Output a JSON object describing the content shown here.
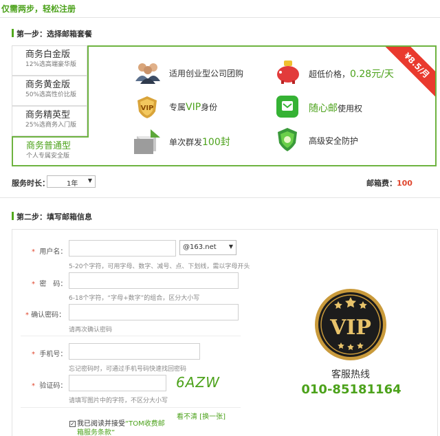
{
  "header": {
    "title": "仅需两步，轻松注册"
  },
  "step1": {
    "title": "第一步：选择邮箱套餐"
  },
  "plans": [
    {
      "name": "商务白金版",
      "desc": "12%选高端豪华版"
    },
    {
      "name": "商务黄金版",
      "desc": "50%选高性价比版"
    },
    {
      "name": "商务精英型",
      "desc": "25%选商务入门版"
    },
    {
      "name": "商务普通型",
      "desc": "个人专属安全版"
    }
  ],
  "features": {
    "f1": "适用创业型公司团购",
    "f2_prefix": "超低价格，",
    "f2_price": "0.28元/天",
    "f3_prefix": "专属",
    "f3_vip": "VIP",
    "f3_suffix": "身份",
    "f4_prefix": "随心邮",
    "f4_suffix": "使用权",
    "f5_prefix": "单次群发",
    "f5_num": "100封",
    "f6": "高级安全防护"
  },
  "ribbon": {
    "price": "¥8.5/月"
  },
  "service": {
    "label": "服务时长：",
    "duration": "1年",
    "fee_label": "邮箱费：",
    "fee_value": "100"
  },
  "step2": {
    "title": "第二步：填写邮箱信息"
  },
  "form": {
    "username_label": "用户名：",
    "domain": "@163.net",
    "username_hint": "5-20个字符，可用字母、数字、减号、点、下划线，需以字母开头",
    "password_label": "密　码：",
    "password_hint": "6-18个字符，“字母+数字”的组合，区分大小写",
    "confirm_label": "确认密码：",
    "confirm_hint": "请再次确认密码",
    "phone_label": "手机号：",
    "phone_hint": "忘记密码时，可通过手机号码快速找回密码",
    "captcha_label": "验证码：",
    "captcha_text": "6AZW",
    "captcha_hint": "请填写图片中的字符，不区分大小写",
    "refresh_text": "看不清 [换一张]",
    "agree_text": "我已阅读并接受",
    "agree_link": "“TOM收费邮箱服务条款”"
  },
  "vip": {
    "badge": "VIP",
    "hotline_label": "客服热线",
    "hotline_number": "010-85181164"
  },
  "colors": {
    "green": "#4ca21b",
    "red": "#e0462e",
    "ribbon": "#e93a2e",
    "badge_gold": "#c99a3b"
  }
}
